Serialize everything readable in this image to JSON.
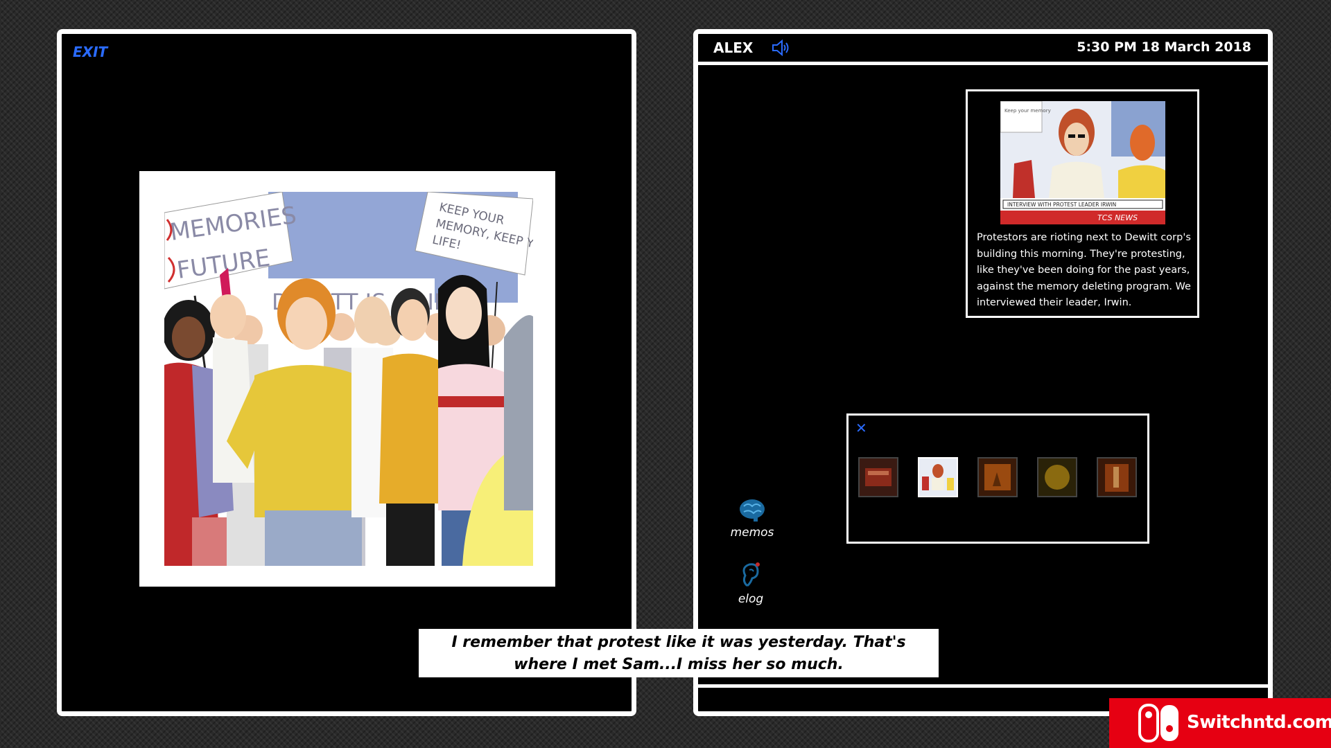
{
  "left_panel": {
    "exit_label": "EXIT"
  },
  "header": {
    "character_name": "ALEX",
    "datetime": "5:30 PM 18 March 2018"
  },
  "news": {
    "text": "Protestors are rioting next to Dewitt corp's building this morning. They're protesting, like they've been doing for the past years, against the memory deleting program. We interviewed their leader, Irwin.",
    "banner": "INTERVIEW WITH PROTEST LEADER IRWIN",
    "channel": "TCS NEWS",
    "sign": "Keep your memory"
  },
  "photo": {
    "signs": [
      "MEMORIES",
      "FUTURE",
      "KEEP YOUR MEMORY, KEEP YOUR LIFE!",
      "DEWITT IS A LIE"
    ]
  },
  "tray": {
    "close_label": "✕",
    "thumbnails": [
      {
        "icon": "newspaper-thumbnail",
        "active": false,
        "color": "#8a2a1a"
      },
      {
        "icon": "protest-thumbnail",
        "active": true,
        "color": "#ffffff"
      },
      {
        "icon": "orange-thumbnail",
        "active": false,
        "color": "#9a4a10"
      },
      {
        "icon": "yellow-thumbnail",
        "active": false,
        "color": "#8a6a10"
      },
      {
        "icon": "bottle-thumbnail",
        "active": false,
        "color": "#8a3a10"
      }
    ]
  },
  "sidebar": {
    "memos_label": "memos",
    "memos_icon": "brain-icon",
    "elog_label": "elog",
    "elog_icon": "ear-icon"
  },
  "subtitle": {
    "text": "I remember that protest like it was yesterday. That's where I met Sam...I miss her so much."
  },
  "watermark": {
    "text": "Switchntd.com",
    "icon": "nintendo-switch-logo"
  },
  "colors": {
    "accent_blue": "#2a6bff",
    "watermark_red": "#e60012"
  }
}
